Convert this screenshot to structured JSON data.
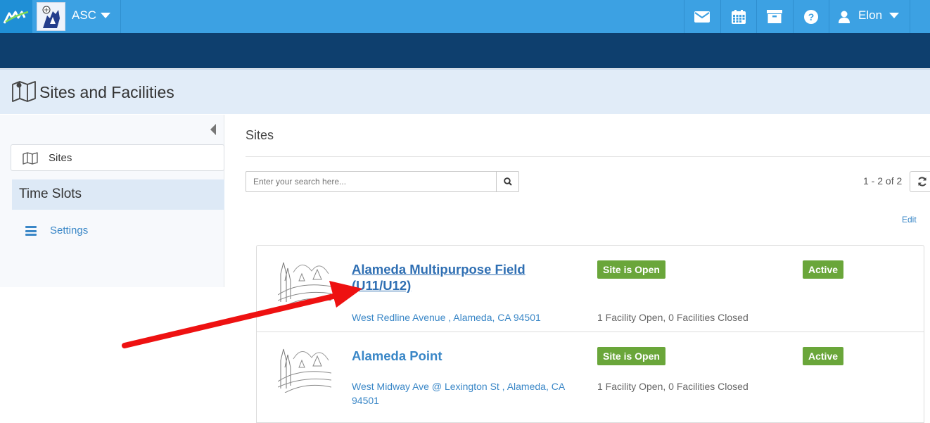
{
  "topbar": {
    "org_name": "ASC",
    "user_name": "Elon",
    "icons": [
      "envelope-icon",
      "calendar-icon",
      "archive-icon",
      "question-icon",
      "user-icon"
    ],
    "bar_color": "#3ca1e3",
    "nav_color": "#0e3f6e"
  },
  "page": {
    "title": "Sites and Facilities"
  },
  "sidebar": {
    "items": [
      {
        "label": "Sites",
        "icon": "map-icon"
      },
      {
        "label": "Time Slots"
      },
      {
        "label": "Settings",
        "icon": "hamburger-icon"
      }
    ]
  },
  "main": {
    "heading": "Sites",
    "search_placeholder": "Enter your search here...",
    "pager": "1 - 2 of 2",
    "edit_label": "Edit",
    "sites": [
      {
        "name": "Alameda Multipurpose Field (U11/U12)",
        "address": "West Redline Avenue , Alameda, CA 94501",
        "site_status": "Site is Open",
        "active_status": "Active",
        "facilities": "1 Facility Open, 0 Facilities Closed"
      },
      {
        "name": "Alameda Point",
        "address": "West Midway Ave @ Lexington St , Alameda, CA 94501",
        "site_status": "Site is Open",
        "active_status": "Active",
        "facilities": "1 Facility Open, 0 Facilities Closed"
      }
    ],
    "badge_color": "#6aa63a",
    "link_color": "#3a87c7"
  },
  "annotation": {
    "arrow_color": "#ee1111"
  }
}
